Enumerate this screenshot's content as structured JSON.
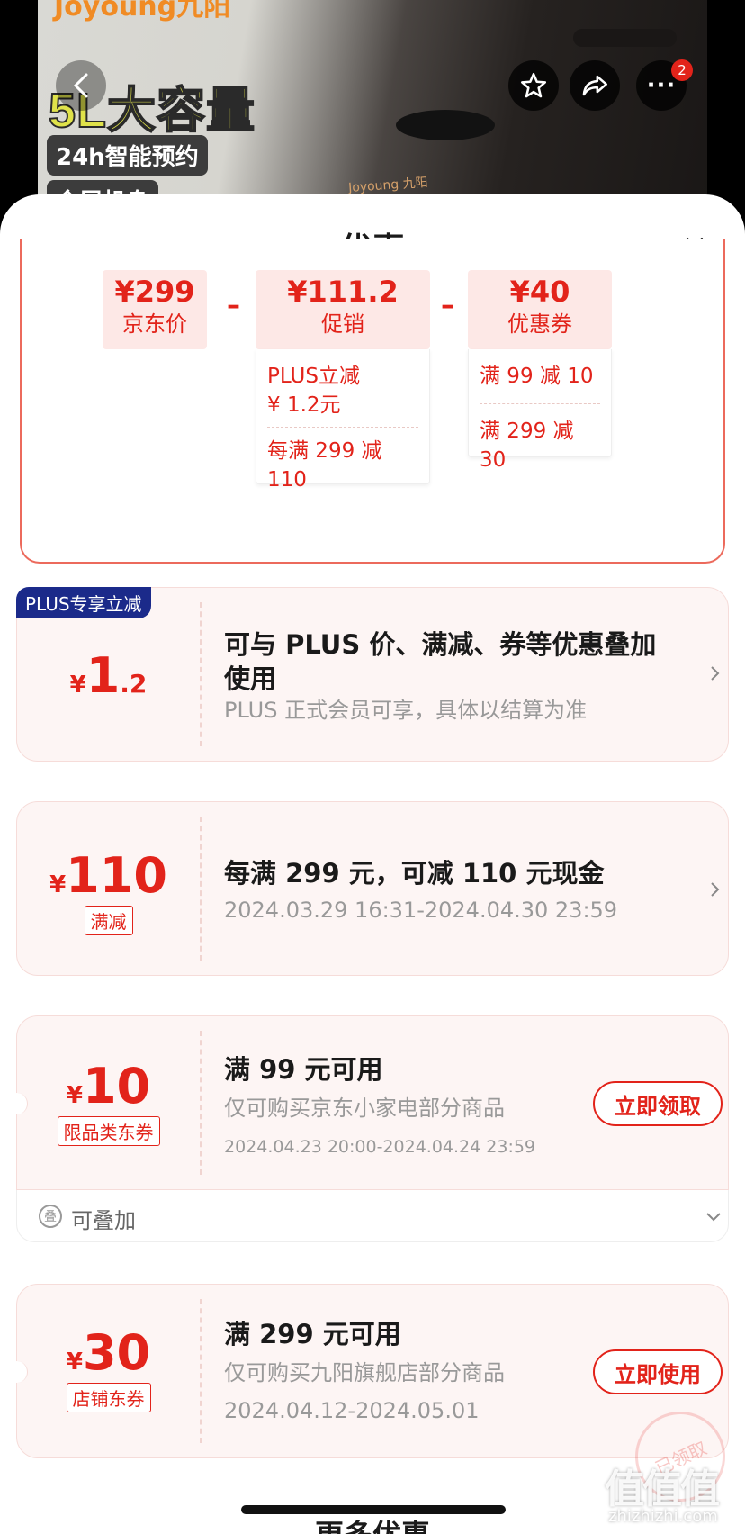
{
  "hero": {
    "brand": "Joyoung九阳",
    "headline": "5L大容量",
    "tag1": "24h智能预约",
    "tag2": "金属机身",
    "product_logo": "Joyoung 九阳",
    "cart_badge": "2"
  },
  "sheet": {
    "title": "优惠"
  },
  "breakdown": {
    "base": {
      "value": "¥299",
      "label": "京东价"
    },
    "promo": {
      "value": "¥111.2",
      "label": "促销",
      "lines": [
        "PLUS立减",
        "¥ 1.2元",
        "每满 299 减 110"
      ]
    },
    "coupon": {
      "value": "¥40",
      "label": "优惠券",
      "lines": [
        "满 99 减 10",
        "满 299 减 30"
      ]
    },
    "minus": "–"
  },
  "coupons": [
    {
      "flag": "PLUS专享立减",
      "yen": "¥",
      "num": "1",
      "dec": ".2",
      "title_l1": "可与 PLUS 价、满减、券等优惠叠加",
      "title_l2": "使用",
      "sub": "PLUS 正式会员可享，具体以结算为准"
    },
    {
      "yen": "¥",
      "num": "110",
      "tag": "满减",
      "title": "每满 299 元，可减 110 元现金",
      "sub": "2024.03.29 16:31-2024.04.30 23:59"
    },
    {
      "yen": "¥",
      "num": "10",
      "tag": "限品类东券",
      "title": "满 99 元可用",
      "sub": "仅可购买京东小家电部分商品",
      "date": "2024.04.23 20:00-2024.04.24 23:59",
      "action": "立即领取",
      "stack_label": "可叠加",
      "stack_icon": "叠"
    },
    {
      "yen": "¥",
      "num": "30",
      "tag": "店铺东券",
      "title": "满 299 元可用",
      "sub": "仅可购买九阳旗舰店部分商品",
      "date": "2024.04.12-2024.05.01",
      "action": "立即使用",
      "stamp": "已领取"
    }
  ],
  "more": "更多优惠",
  "watermark": {
    "logo": "值值值",
    "url": "zhizhizhi.com"
  },
  "colors": {
    "accent": "#e2231a",
    "plus_flag": "#1b2a8a",
    "coupon_bg": "#fdf5f4"
  }
}
